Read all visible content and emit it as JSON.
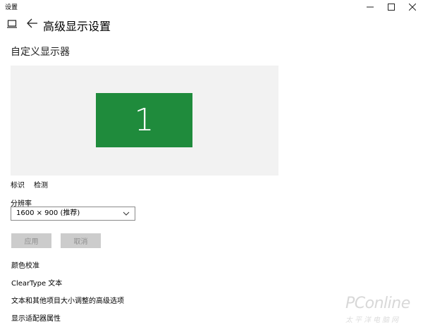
{
  "window": {
    "title": "设置"
  },
  "header": {
    "title": "高级显示设置"
  },
  "main": {
    "section_title": "自定义显示器",
    "monitor_number": "1",
    "identify_link": "标识",
    "detect_link": "检测",
    "resolution_label": "分辨率",
    "resolution_value": "1600 × 900 (推荐)",
    "apply_button": "应用",
    "cancel_button": "取消",
    "links": [
      "颜色校准",
      "ClearType 文本",
      "文本和其他项目大小调整的高级选项",
      "显示适配器属性"
    ]
  },
  "watermark": {
    "main": "PConline",
    "sub": "太平洋电脑网"
  },
  "colors": {
    "monitor_tile": "#1f8b3c",
    "canvas_bg": "#f2f2f2",
    "disabled_button": "#cccccc"
  }
}
